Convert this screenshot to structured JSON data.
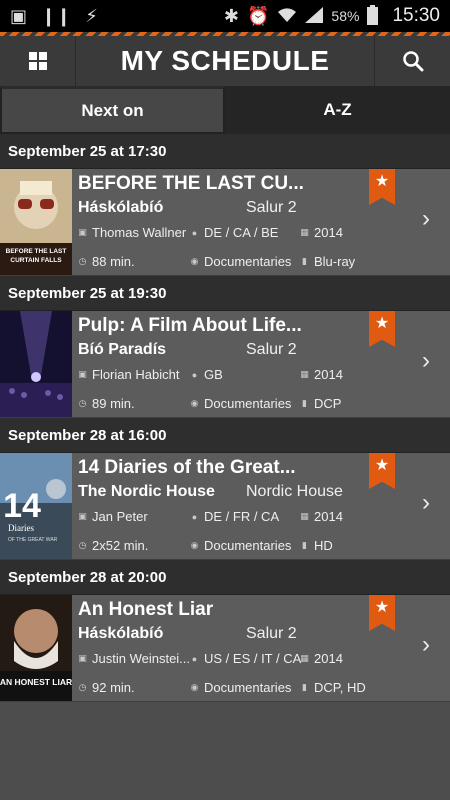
{
  "status_bar": {
    "left_icons": [
      "image-icon",
      "pause-icon",
      "flash-icon"
    ],
    "right_icons": [
      "bluetooth-icon",
      "alarm-icon",
      "wifi-icon",
      "signal-icon"
    ],
    "battery": "58%",
    "time": "15:30"
  },
  "app_bar": {
    "title": "MY SCHEDULE",
    "menu_icon": "grid-icon",
    "search_icon": "search-icon"
  },
  "tabs": [
    {
      "label": "Next on",
      "active": true
    },
    {
      "label": "A-Z",
      "active": false
    }
  ],
  "colors": {
    "accent": "#e05a12",
    "background": "#4d4d4d",
    "item_bg": "#5c5c5c"
  },
  "sections": [
    {
      "header": "September 25 at 17:30",
      "item": {
        "title": "BEFORE THE LAST CU...",
        "venue": "Háskólabíó",
        "hall": "Salur 2",
        "director": "Thomas Wallner",
        "country": "DE / CA / BE",
        "year": "2014",
        "length": "88 min.",
        "genre": "Documentaries",
        "format": "Blu-ray",
        "poster_text": "BEFORE THE LAST CURTAIN FALLS"
      }
    },
    {
      "header": "September 25 at 19:30",
      "item": {
        "title": "Pulp: A Film About Life...",
        "venue": "Bíó Paradís",
        "hall": "Salur 2",
        "director": "Florian Habicht",
        "country": "GB",
        "year": "2014",
        "length": "89 min.",
        "genre": "Documentaries",
        "format": "DCP",
        "poster_text": ""
      }
    },
    {
      "header": "September 28 at 16:00",
      "item": {
        "title": "14 Diaries of the Great...",
        "venue": "The Nordic House",
        "hall": "Nordic House",
        "director": "Jan Peter",
        "country": "DE / FR / CA",
        "year": "2014",
        "length": "2x52 min.",
        "genre": "Documentaries",
        "format": "HD",
        "poster_text": "14 Diaries"
      }
    },
    {
      "header": "September 28 at 20:00",
      "item": {
        "title": "An Honest Liar",
        "venue": "Háskólabíó",
        "hall": "Salur 2",
        "director": "Justin Weinstei...",
        "country": "US / ES / IT / CA",
        "year": "2014",
        "length": "92 min.",
        "genre": "Documentaries",
        "format": "DCP, HD",
        "poster_text": "AN HONEST LIAR"
      }
    }
  ]
}
